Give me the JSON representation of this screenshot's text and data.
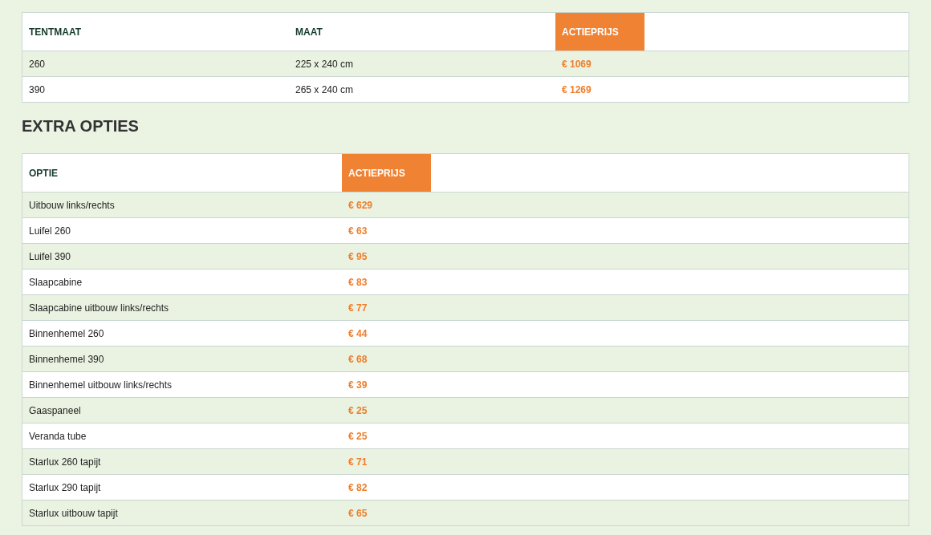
{
  "price_table": {
    "columns": [
      {
        "label": "TENTMAAT",
        "kind": "plain"
      },
      {
        "label": "MAAT",
        "kind": "plain"
      },
      {
        "label": "ACTIEPRIJS",
        "kind": "price"
      }
    ],
    "rows": [
      {
        "cells": [
          "260",
          "225 x 240 cm",
          "€ 1069"
        ]
      },
      {
        "cells": [
          "390",
          "265 x 240 cm",
          "€ 1269"
        ]
      }
    ]
  },
  "section_title": "EXTRA OPTIES",
  "options_table": {
    "columns": [
      {
        "label": "OPTIE",
        "kind": "plain"
      },
      {
        "label": "ACTIEPRIJS",
        "kind": "price"
      }
    ],
    "rows": [
      {
        "cells": [
          "Uitbouw links/rechts",
          "€ 629"
        ]
      },
      {
        "cells": [
          "Luifel 260",
          "€ 63"
        ]
      },
      {
        "cells": [
          "Luifel 390",
          "€ 95"
        ]
      },
      {
        "cells": [
          "Slaapcabine",
          "€ 83"
        ]
      },
      {
        "cells": [
          "Slaapcabine uitbouw links/rechts",
          "€ 77"
        ]
      },
      {
        "cells": [
          "Binnenhemel 260",
          "€ 44"
        ]
      },
      {
        "cells": [
          "Binnenhemel 390",
          "€ 68"
        ]
      },
      {
        "cells": [
          "Binnenhemel uitbouw links/rechts",
          "€ 39"
        ]
      },
      {
        "cells": [
          "Gaaspaneel",
          "€ 25"
        ]
      },
      {
        "cells": [
          "Veranda tube",
          "€ 25"
        ]
      },
      {
        "cells": [
          "Starlux 260 tapijt",
          "€ 71"
        ]
      },
      {
        "cells": [
          "Starlux 290 tapijt",
          "€ 82"
        ]
      },
      {
        "cells": [
          "Starlux uitbouw tapijt",
          "€ 65"
        ]
      }
    ]
  }
}
